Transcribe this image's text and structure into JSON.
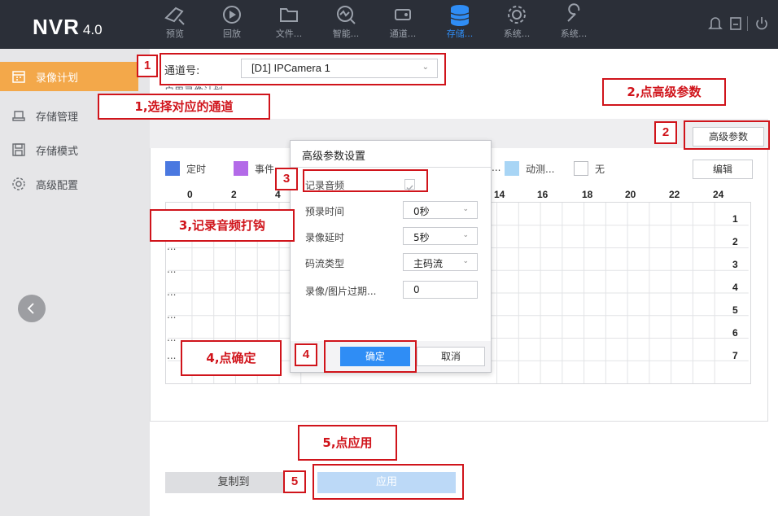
{
  "app": {
    "logo_main": "NVR",
    "logo_version": "4.0"
  },
  "nav": [
    {
      "icon": "preview-icon",
      "label": "预览"
    },
    {
      "icon": "playback-icon",
      "label": "回放"
    },
    {
      "icon": "folder-icon",
      "label": "文件..."
    },
    {
      "icon": "smart-icon",
      "label": "智能..."
    },
    {
      "icon": "channel-icon",
      "label": "通道..."
    },
    {
      "icon": "storage-icon",
      "label": "存储...",
      "active": true
    },
    {
      "icon": "gear-icon",
      "label": "系统..."
    },
    {
      "icon": "wrench-icon",
      "label": "系统..."
    }
  ],
  "sidebar": {
    "items": [
      {
        "icon": "calendar-icon",
        "label": "录像计划",
        "active": true
      },
      {
        "icon": "storage-manage-icon",
        "label": "存储管理"
      },
      {
        "icon": "floppy-icon",
        "label": "存储模式"
      },
      {
        "icon": "advanced-config-icon",
        "label": "高级配置"
      }
    ]
  },
  "main": {
    "channel_label": "通道号:",
    "channel_value": "[D1] IPCamera 1",
    "cut_text": "启用录像计划",
    "advanced_button": "高级参数",
    "edit_button": "编辑",
    "legend": [
      {
        "label": "定时",
        "color": "#4a78e0"
      },
      {
        "label": "事件",
        "color": "#b36ae8"
      },
      {
        "label": "...",
        "color": ""
      },
      {
        "label": "动测...",
        "color": "#a8d5f5"
      },
      {
        "label": "无",
        "color": "#ffffff"
      }
    ],
    "hours": [
      "0",
      "2",
      "4",
      "14",
      "16",
      "18",
      "20",
      "22",
      "24"
    ],
    "days": [
      "1",
      "2",
      "3",
      "4",
      "5",
      "6",
      "7"
    ],
    "row_ellipsis": "...",
    "copy_button": "复制到",
    "apply_button": "应用"
  },
  "dialog": {
    "title": "高级参数设置",
    "record_audio_label": "记录音频",
    "record_audio_checked": true,
    "prerecord_label": "预录时间",
    "prerecord_value": "0秒",
    "postrecord_label": "录像延时",
    "postrecord_value": "5秒",
    "stream_label": "码流类型",
    "stream_value": "主码流",
    "expire_label": "录像/图片过期...",
    "expire_value": "0",
    "ok_button": "确定",
    "cancel_button": "取消"
  },
  "annotations": {
    "n1": "1",
    "n2": "2",
    "n3": "3",
    "n4": "4",
    "n5": "5",
    "step1": "1,选择对应的通道",
    "step2": "2,点高级参数",
    "step3": "3,记录音频打钩",
    "step4": "4,点确定",
    "step5": "5,点应用"
  },
  "colors": {
    "accent": "#2f8df5",
    "sidebar_active": "#f3a84a",
    "annotation": "#d0141b",
    "topbar": "#2b2f38"
  }
}
